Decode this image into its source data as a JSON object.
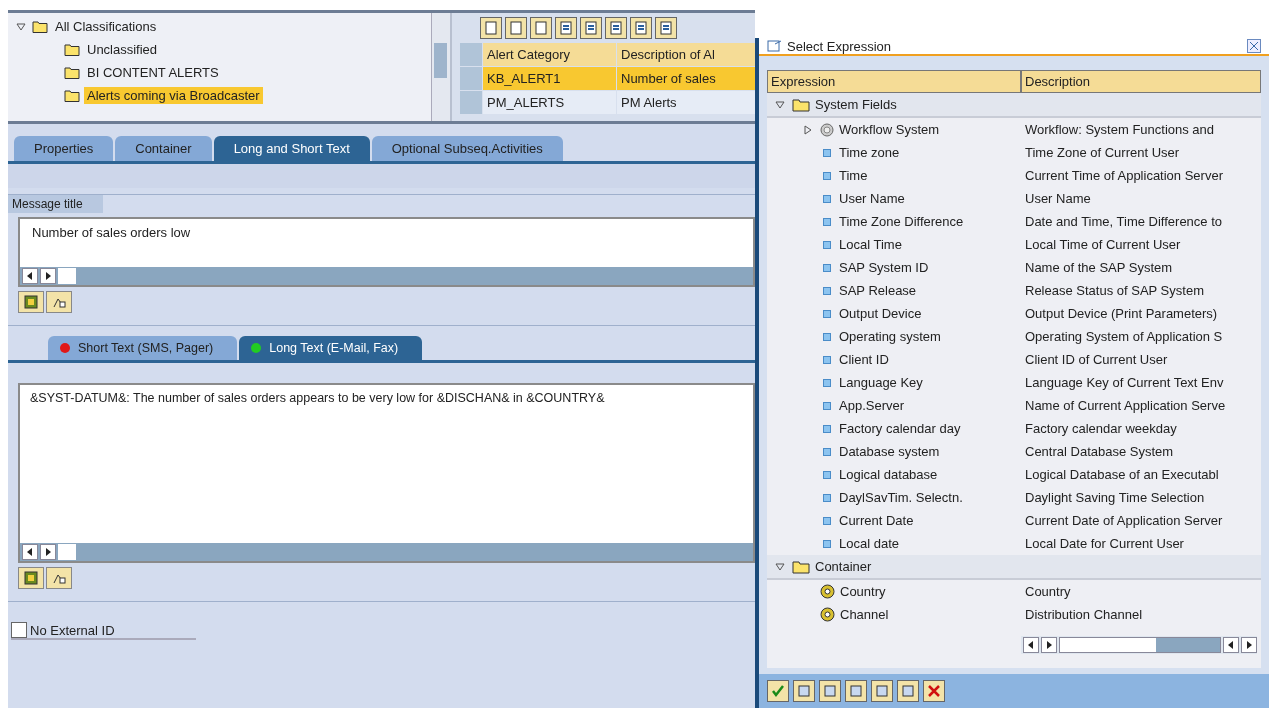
{
  "tree": {
    "items": [
      {
        "label": "All Classifications",
        "kind": "folder",
        "expanded": true,
        "selected": false,
        "children": [
          {
            "label": "Unclassified",
            "kind": "folder",
            "selected": false
          },
          {
            "label": "BI CONTENT ALERTS",
            "kind": "folder",
            "selected": false
          },
          {
            "label": "Alerts coming via Broadcaster",
            "kind": "folder",
            "selected": true
          }
        ]
      }
    ]
  },
  "alert_table": {
    "columns": [
      "Alert Category",
      "Description of Al"
    ],
    "rows": [
      {
        "cells": [
          "KB_ALERT1",
          "Number of sales"
        ],
        "selected": true
      },
      {
        "cells": [
          "PM_ALERTS",
          "PM Alerts"
        ],
        "selected": false
      }
    ]
  },
  "tabs": [
    {
      "label": "Properties",
      "selected": false
    },
    {
      "label": "Container",
      "selected": false
    },
    {
      "label": "Long and Short Text",
      "selected": true
    },
    {
      "label": "Optional Subseq.Activities",
      "selected": false
    }
  ],
  "message_title": {
    "label": "Message title",
    "value": "Number of sales orders low"
  },
  "text_tabs": [
    {
      "label": "Short Text (SMS, Pager)",
      "color": "#e01818",
      "selected": false
    },
    {
      "label": "Long Text (E-Mail, Fax)",
      "color": "#22cc22",
      "selected": true
    }
  ],
  "long_text": {
    "value": "&SYST-DATUM&: The number of sales orders appears to be very low for &DISCHAN& in &COUNTRY&"
  },
  "no_external_id": {
    "label": "No External ID",
    "checked": false
  },
  "dialog": {
    "title": "Select Expression",
    "columns": [
      "Expression",
      "Description"
    ],
    "rows": [
      {
        "kind": "folder",
        "label": "System Fields",
        "expanded": true,
        "children": [
          {
            "kind": "structure",
            "label": "Workflow System",
            "description": "Workflow: System Functions and",
            "expanded": false
          },
          {
            "kind": "field",
            "label": "Time zone",
            "description": "Time Zone of Current User"
          },
          {
            "kind": "field",
            "label": "Time",
            "description": "Current Time of Application Server"
          },
          {
            "kind": "field",
            "label": "User Name",
            "description": "User Name"
          },
          {
            "kind": "field",
            "label": "Time Zone Difference",
            "description": "Date and Time, Time Difference to"
          },
          {
            "kind": "field",
            "label": "Local Time",
            "description": "Local Time of Current User"
          },
          {
            "kind": "field",
            "label": "SAP System ID",
            "description": "Name of the SAP System"
          },
          {
            "kind": "field",
            "label": "SAP Release",
            "description": "Release Status of SAP System"
          },
          {
            "kind": "field",
            "label": "Output Device",
            "description": "Output Device (Print Parameters)"
          },
          {
            "kind": "field",
            "label": "Operating system",
            "description": "Operating System of Application S"
          },
          {
            "kind": "field",
            "label": "Client ID",
            "description": "Client ID of Current User"
          },
          {
            "kind": "field",
            "label": "Language Key",
            "description": "Language Key of Current Text Env"
          },
          {
            "kind": "field",
            "label": "App.Server",
            "description": "Name of Current Application Serve"
          },
          {
            "kind": "field",
            "label": "Factory calendar day",
            "description": "Factory calendar weekday"
          },
          {
            "kind": "field",
            "label": "Database system",
            "description": "Central Database System"
          },
          {
            "kind": "field",
            "label": "Logical database",
            "description": "Logical Database of an Executabl"
          },
          {
            "kind": "field",
            "label": "DaylSavTim. Selectn.",
            "description": "Daylight Saving Time Selection"
          },
          {
            "kind": "field",
            "label": "Current Date",
            "description": "Current Date of Application Server"
          },
          {
            "kind": "field",
            "label": "Local date",
            "description": "Local Date for Current User"
          }
        ]
      },
      {
        "kind": "folder",
        "label": "Container",
        "expanded": true,
        "children": [
          {
            "kind": "element",
            "label": "Country",
            "description": "Country"
          },
          {
            "kind": "element",
            "label": "Channel",
            "description": "Distribution Channel"
          }
        ]
      }
    ]
  }
}
